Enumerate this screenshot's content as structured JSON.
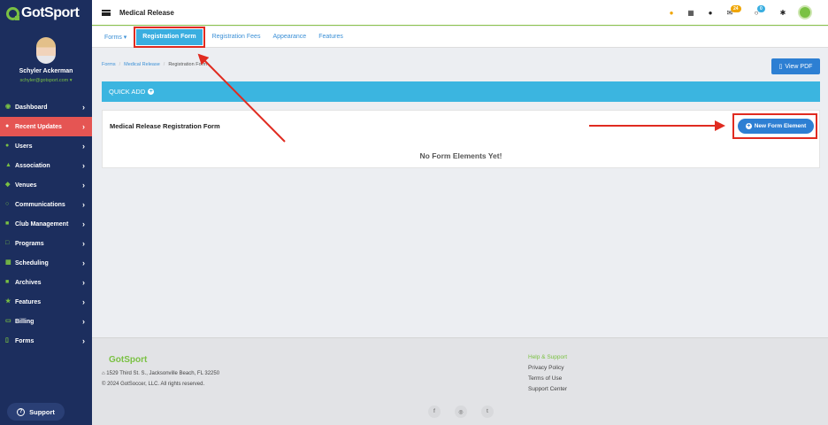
{
  "app": {
    "logo_text_1": "Got",
    "logo_text_2": "Sport",
    "page_heading": "Medical Release"
  },
  "profile": {
    "name": "Schyler Ackerman",
    "email": "schyler@gotsport.com ▾"
  },
  "sidebar": {
    "items": [
      {
        "label": "Dashboard",
        "icon": "dashboard-icon"
      },
      {
        "label": "Recent Updates",
        "icon": "bell-icon"
      },
      {
        "label": "Users",
        "icon": "users-icon"
      },
      {
        "label": "Association",
        "icon": "sitemap-icon"
      },
      {
        "label": "Venues",
        "icon": "map-icon"
      },
      {
        "label": "Communications",
        "icon": "comments-icon"
      },
      {
        "label": "Club Management",
        "icon": "club-icon"
      },
      {
        "label": "Programs",
        "icon": "programs-icon"
      },
      {
        "label": "Scheduling",
        "icon": "calendar-icon"
      },
      {
        "label": "Archives",
        "icon": "archive-icon"
      },
      {
        "label": "Features",
        "icon": "star-icon"
      },
      {
        "label": "Billing",
        "icon": "credit-card-icon"
      },
      {
        "label": "Forms",
        "icon": "file-icon"
      }
    ],
    "support_label": "Support"
  },
  "topbar": {
    "mail_count": "24",
    "chat_count": "0"
  },
  "subnav": {
    "tabs": [
      "Forms ▾",
      "Registration Form",
      "Registration Fees",
      "Appearance",
      "Features"
    ]
  },
  "breadcrumb": {
    "crumbs": [
      "Forms",
      "Medical Release",
      "Registration Form"
    ]
  },
  "actions": {
    "view_pdf": "View PDF",
    "quick_add": "QUICK ADD",
    "new_form_element": "New Form Element"
  },
  "form": {
    "title": "Medical Release Registration Form",
    "empty_message": "No Form Elements Yet!"
  },
  "footer": {
    "logo": "GotSport",
    "address": "1529 Third St. S., Jacksonville Beach, FL 32250",
    "copyright": "© 2024 GotSoccer, LLC. All rights reserved.",
    "links": [
      "Help & Support",
      "Privacy Policy",
      "Terms of Use",
      "Support Center"
    ]
  },
  "colors": {
    "sidebar_bg": "#1c2e5e",
    "active_nav": "#e55553",
    "brand_green": "#7ac143",
    "primary_blue": "#2d7fd3",
    "quick_add_bg": "#3bb5e0",
    "annotation_red": "#e02b20"
  }
}
